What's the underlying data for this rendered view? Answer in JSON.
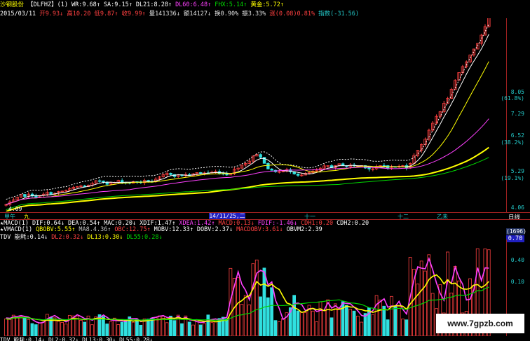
{
  "header": {
    "stock_name": "沙钢股份",
    "stock_code": "【DLFHZ】(1)",
    "indicators1": [
      {
        "text": "WR:9.68↑",
        "color": "#ffffff"
      },
      {
        "text": "SA:9.15↑",
        "color": "#ffffff"
      },
      {
        "text": "DL21:8.28↑",
        "color": "#ffffff"
      },
      {
        "text": "DL60:6.48↑",
        "color": "#ff40ff"
      },
      {
        "text": "FHX:5.14↑",
        "color": "#00d800"
      },
      {
        "text": "黄金:5.72↑",
        "color": "#ffff00"
      }
    ],
    "date": "2015/03/11",
    "quote2": [
      {
        "text": "开9.93↓",
        "color": "#ff4040"
      },
      {
        "text": "高10.20",
        "color": "#ff4040"
      },
      {
        "text": "低9.87↑",
        "color": "#ff4040"
      },
      {
        "text": "收9.99↑",
        "color": "#ff4040"
      },
      {
        "text": "量141336↓",
        "color": "#e0e0e0"
      },
      {
        "text": "额14127↓",
        "color": "#e0e0e0"
      },
      {
        "text": "换0.90%",
        "color": "#e0e0e0"
      },
      {
        "text": "振3.33%",
        "color": "#e0e0e0"
      },
      {
        "text": "涨(0.08)0.81%",
        "color": "#ff4040"
      },
      {
        "text": "指数(-31.56)",
        "color": "#23c8c8"
      }
    ]
  },
  "price_axis": {
    "labels": [
      "8.05",
      "(61.8%)",
      "7.29",
      "6.52",
      "(38.2%)",
      "5.29",
      "(19.1%)",
      "4.06"
    ],
    "low_marker": "4.09"
  },
  "time_axis": {
    "labels": [
      "甲午",
      "九",
      "十一",
      "十二",
      "乙未"
    ],
    "cursor_date": "14/11/25,二",
    "period": "日线"
  },
  "indicator_rows": {
    "row1": [
      {
        "text": "★MACD(1)",
        "color": "#ffffff"
      },
      {
        "text": "DIF:0.64↓",
        "color": "#ffffff"
      },
      {
        "text": "DEA:0.54↑",
        "color": "#ffffff"
      },
      {
        "text": "MAC:0.20↓",
        "color": "#ffffff"
      },
      {
        "text": "XDIF:1.47↑",
        "color": "#ffffff"
      },
      {
        "text": "XDEA:1.42↑",
        "color": "#ff40ff"
      },
      {
        "text": "MACD:0.13↓",
        "color": "#ff4040"
      },
      {
        "text": "FDIF:-1.46↓",
        "color": "#ff40ff"
      },
      {
        "text": "CDH1:0.20",
        "color": "#ff4040"
      },
      {
        "text": "CDH2:0.20",
        "color": "#ffffff"
      }
    ],
    "row2": [
      {
        "text": "★VMACD(1)",
        "color": "#ffffff"
      },
      {
        "text": "QBOBV:5.55↑",
        "color": "#ffff00"
      },
      {
        "text": "MA8.4.36↑",
        "color": "#c0c0c0"
      },
      {
        "text": "OBC:12.75↑",
        "color": "#ff4040"
      },
      {
        "text": "MOBV:12.33↑",
        "color": "#ffffff"
      },
      {
        "text": "DOBV:2.37↓",
        "color": "#ffffff"
      },
      {
        "text": "MACDOBV:3.61↓",
        "color": "#ff4040"
      },
      {
        "text": "OBVM2:2.39",
        "color": "#ffffff"
      }
    ],
    "row3": [
      {
        "text": "TDV 能耗:0.14↓",
        "color": "#ffffff"
      },
      {
        "text": "DL2:0.32↓",
        "color": "#ff4040"
      },
      {
        "text": "DL13:0.30↓",
        "color": "#ffff00"
      },
      {
        "text": "DL55:0.28↓",
        "color": "#00d800"
      }
    ]
  },
  "indicator_axis": {
    "badge_top": "(1696)",
    "badge_value": "0.70",
    "labels": [
      "0.40",
      "0.10"
    ]
  },
  "watermark": "www.7gpzb.com",
  "bottom_cut": "TDV 能耗:0.14↓ DL2:0.32↓ DL13:0.30↓ DL55:0.28↓",
  "colors": {
    "up": "#ff4040",
    "down": "#30e0e0",
    "ma_white": "#ffffff",
    "ma_yellow": "#ffff00",
    "ma_magenta": "#ff40ff",
    "ma_green": "#00d800",
    "axis": "#23c8c8"
  }
}
